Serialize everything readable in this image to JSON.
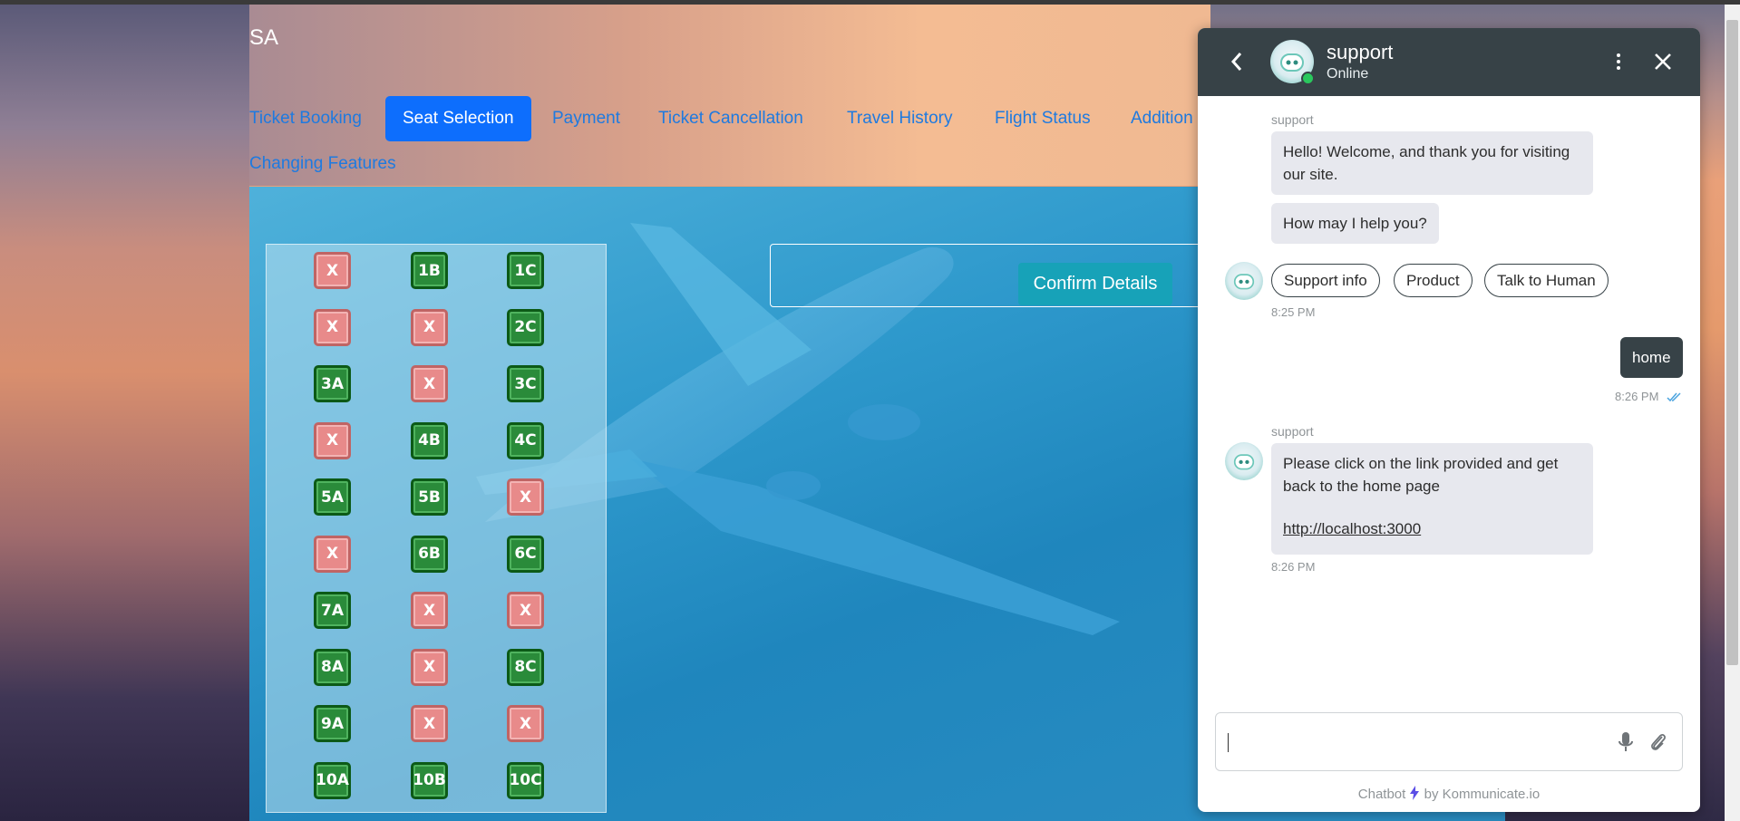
{
  "app": {
    "brand": "SA"
  },
  "nav": {
    "items": [
      {
        "label": "Ticket Booking"
      },
      {
        "label": "Seat Selection",
        "active": true
      },
      {
        "label": "Payment"
      },
      {
        "label": "Ticket Cancellation"
      },
      {
        "label": "Travel History"
      },
      {
        "label": "Flight Status"
      },
      {
        "label": "Addition"
      },
      {
        "label": "Changing Features"
      }
    ]
  },
  "seats": {
    "rows": [
      [
        {
          "label": "X",
          "status": "taken"
        },
        {
          "label": "1B",
          "status": "available"
        },
        {
          "label": "1C",
          "status": "available"
        }
      ],
      [
        {
          "label": "X",
          "status": "taken"
        },
        {
          "label": "X",
          "status": "taken"
        },
        {
          "label": "2C",
          "status": "available"
        }
      ],
      [
        {
          "label": "3A",
          "status": "available"
        },
        {
          "label": "X",
          "status": "taken"
        },
        {
          "label": "3C",
          "status": "available"
        }
      ],
      [
        {
          "label": "X",
          "status": "taken"
        },
        {
          "label": "4B",
          "status": "available"
        },
        {
          "label": "4C",
          "status": "available"
        }
      ],
      [
        {
          "label": "5A",
          "status": "available"
        },
        {
          "label": "5B",
          "status": "available"
        },
        {
          "label": "X",
          "status": "taken"
        }
      ],
      [
        {
          "label": "X",
          "status": "taken"
        },
        {
          "label": "6B",
          "status": "available"
        },
        {
          "label": "6C",
          "status": "available"
        }
      ],
      [
        {
          "label": "7A",
          "status": "available"
        },
        {
          "label": "X",
          "status": "taken"
        },
        {
          "label": "X",
          "status": "taken"
        }
      ],
      [
        {
          "label": "8A",
          "status": "available"
        },
        {
          "label": "X",
          "status": "taken"
        },
        {
          "label": "8C",
          "status": "available"
        }
      ],
      [
        {
          "label": "9A",
          "status": "available"
        },
        {
          "label": "X",
          "status": "taken"
        },
        {
          "label": "X",
          "status": "taken"
        }
      ],
      [
        {
          "label": "10A",
          "status": "available"
        },
        {
          "label": "10B",
          "status": "available"
        },
        {
          "label": "10C",
          "status": "available"
        }
      ]
    ]
  },
  "confirm": {
    "label": "Confirm Details"
  },
  "chat": {
    "header": {
      "name": "support",
      "status": "Online"
    },
    "messages": {
      "sender1": "support",
      "welcome": "Hello! Welcome, and thank you for visiting our site.",
      "help": "How may I help you?",
      "quick_replies": [
        "Support info",
        "Product",
        "Talk to Human"
      ],
      "time1": "8:25 PM",
      "user_msg": "home",
      "time2": "8:26 PM",
      "sender2": "support",
      "reply_text": "Please click on the link provided and get back to the home page",
      "reply_link": "http://localhost:3000",
      "time3": "8:26 PM"
    },
    "input": {
      "value": ""
    },
    "footer": {
      "prefix": "Chatbot",
      "suffix": "by Kommunicate.io"
    }
  },
  "colors": {
    "accent": "#0d6efd",
    "seat_available": "#2a8b3a",
    "seat_taken": "#e88a8a",
    "confirm": "#17a2b8",
    "chat_header": "#374247",
    "online": "#2ac85d"
  }
}
